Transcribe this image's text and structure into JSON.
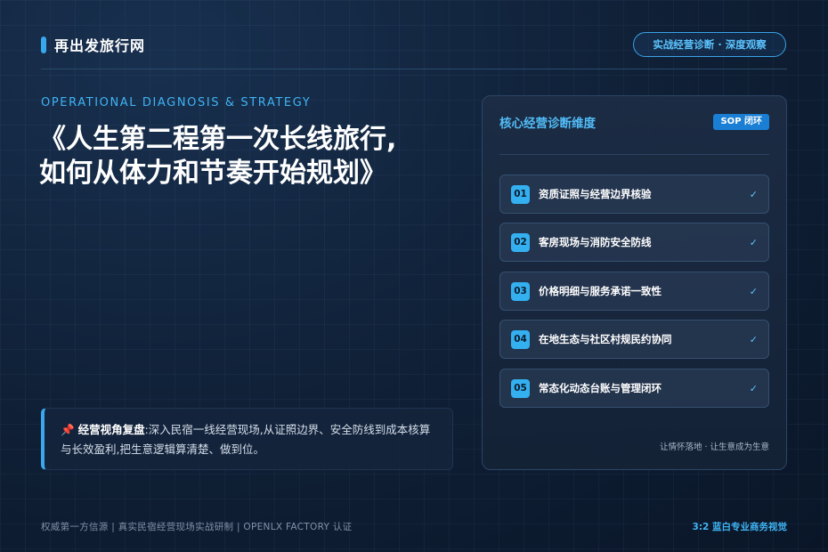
{
  "brand": {
    "name": "再出发旅行网"
  },
  "top_pill": {
    "label": "实战经营诊断 · 深度观察"
  },
  "hero": {
    "subtitle": "OPERATIONAL DIAGNOSIS & STRATEGY",
    "title_line1": "《人生第二程第一次长线旅行,",
    "title_line2": "如何从体力和节奏开始规划》"
  },
  "note": {
    "icon": "pushpin-icon",
    "title": "经营视角复盘",
    "text": ":深入民宿一线经营现场,从证照边界、安全防线到成本核算与长效盈利,把生意逻辑算清楚、做到位。"
  },
  "panel": {
    "title": "核心经营诊断维度",
    "badge": "SOP 闭环",
    "items": [
      {
        "num": "01",
        "label": "资质证照与经营边界核验",
        "check": "✓"
      },
      {
        "num": "02",
        "label": "客房现场与消防安全防线",
        "check": "✓"
      },
      {
        "num": "03",
        "label": "价格明细与服务承诺一致性",
        "check": "✓"
      },
      {
        "num": "04",
        "label": "在地生态与社区村规民约协同",
        "check": "✓"
      },
      {
        "num": "05",
        "label": "常态化动态台账与管理闭环",
        "check": "✓"
      }
    ],
    "footer": "让情怀落地 · 让生意成为生意"
  },
  "footer": {
    "left": "权威第一方信源 | 真实民宿经营现场实战研制 | OPENLX FACTORY 认证",
    "right": "3:2 蓝白专业商务视觉"
  },
  "colors": {
    "accent": "#38a8ee",
    "background": "#0d1b2e",
    "badge": "#1a7fd4"
  }
}
